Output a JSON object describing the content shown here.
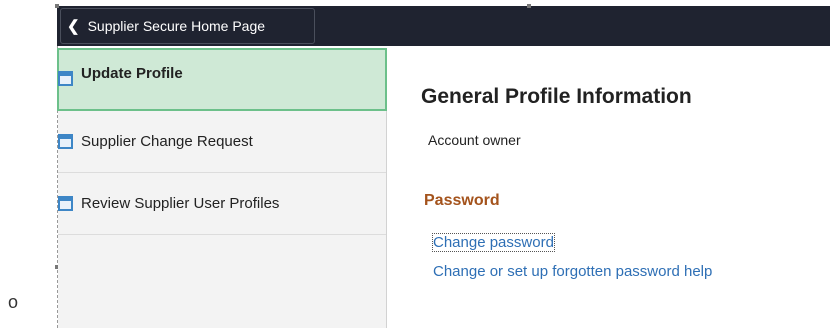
{
  "bullet": "o",
  "header": {
    "back_label": "Supplier Secure Home Page",
    "back_icon": "chevron-left-icon"
  },
  "sidebar": {
    "items": [
      {
        "label": "Update Profile",
        "active": true,
        "icon": "page-icon"
      },
      {
        "label": "Supplier Change Request",
        "active": false,
        "icon": "page-icon"
      },
      {
        "label": "Review Supplier User Profiles",
        "active": false,
        "icon": "page-icon"
      }
    ]
  },
  "main": {
    "title": "General Profile Information",
    "account_owner": "Account owner",
    "password_heading": "Password",
    "links": {
      "change_password": "Change password",
      "forgotten_help": "Change or set up forgotten password help"
    }
  },
  "colors": {
    "topbar": "#1f2330",
    "active_bg": "#cfe9d6",
    "active_border": "#6cc08a",
    "password_heading": "#a4531c",
    "link": "#2e6fb5"
  }
}
